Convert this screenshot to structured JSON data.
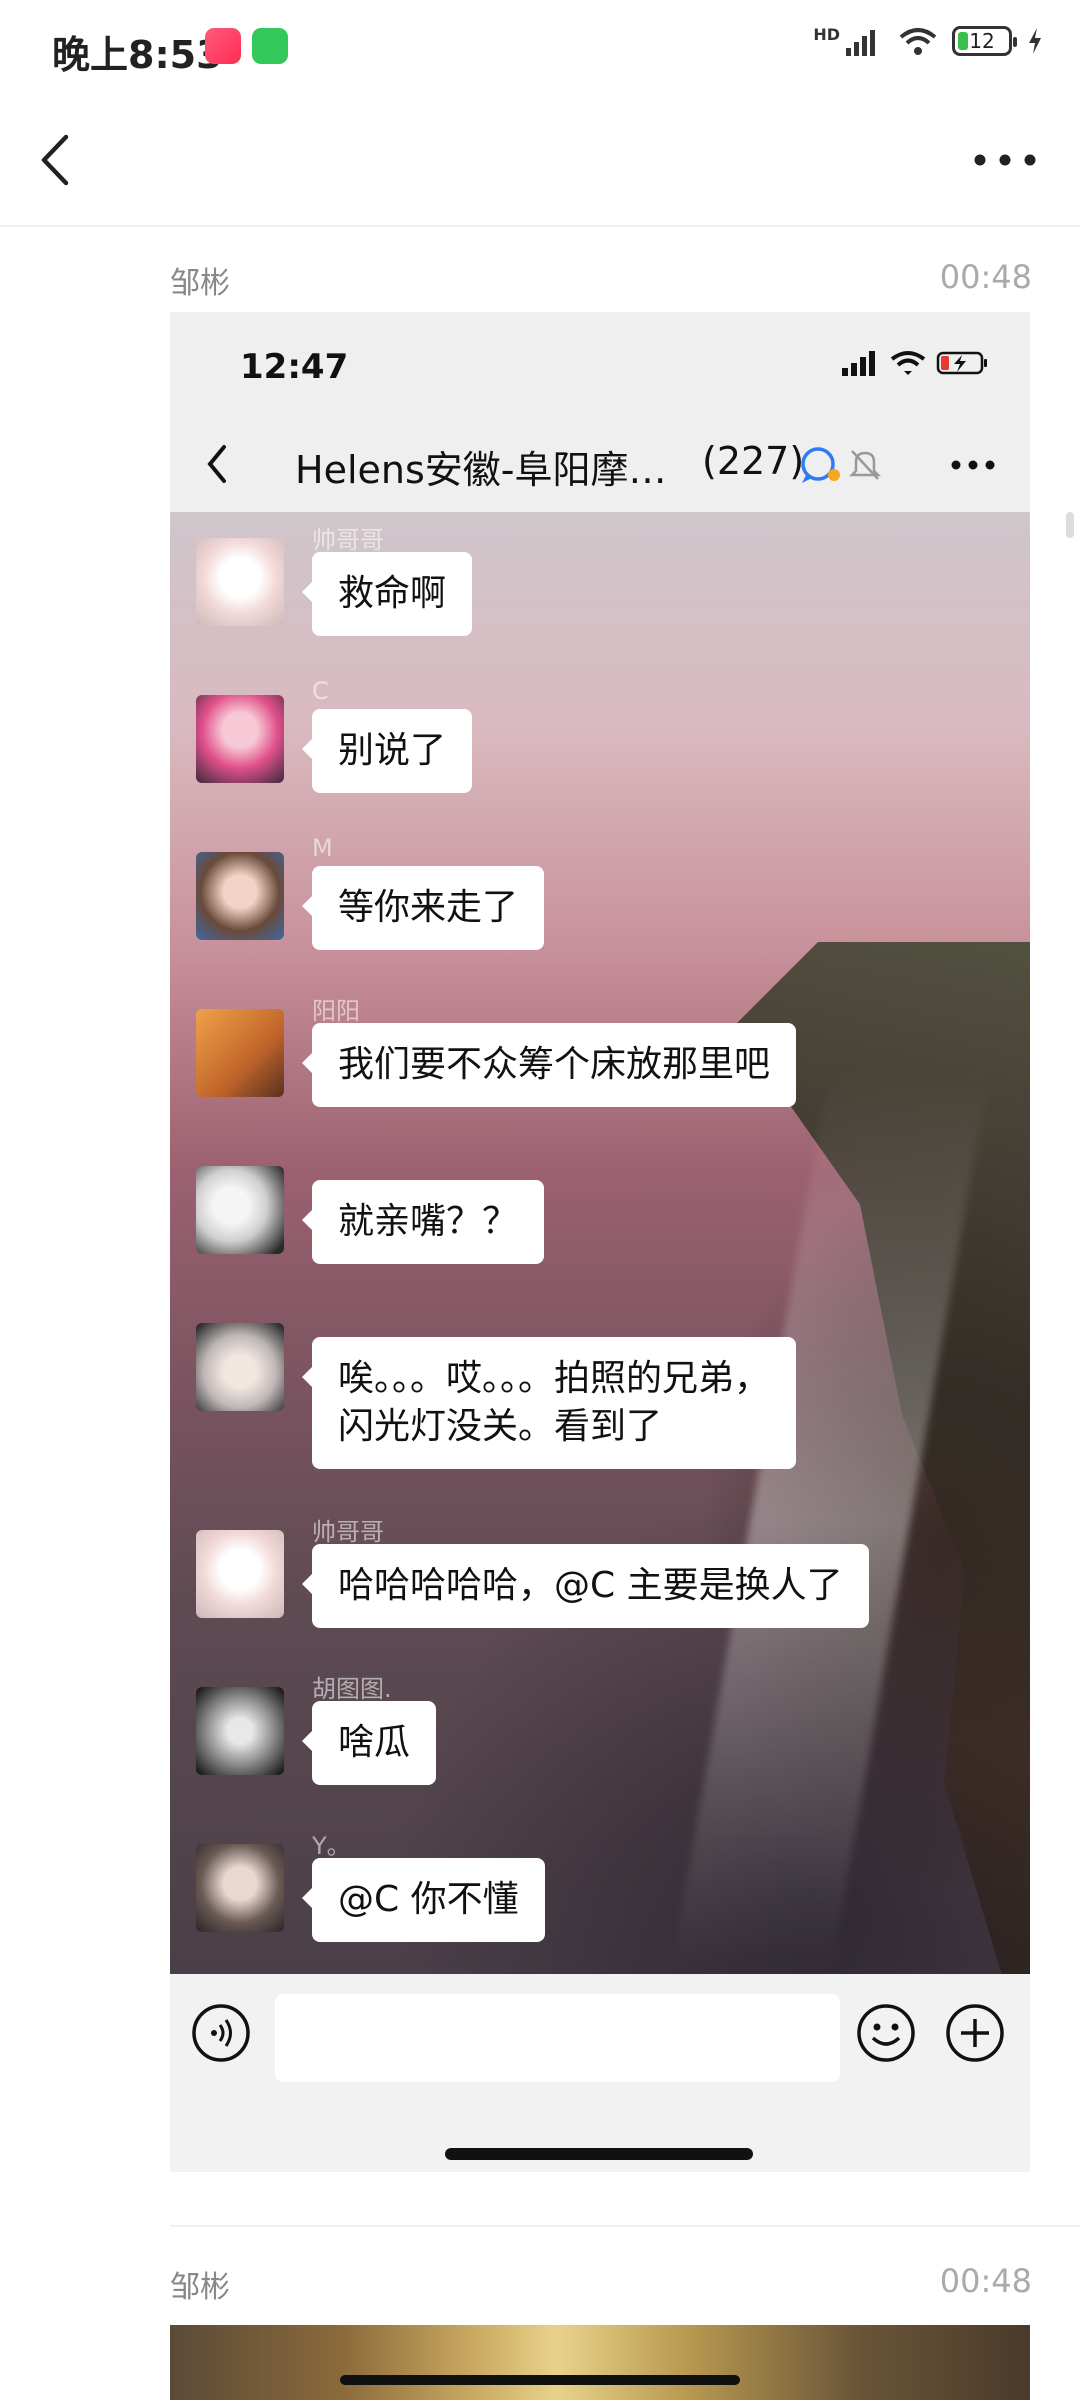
{
  "status_bar": {
    "time": "晚上8:53",
    "battery": "12",
    "network": "HD"
  },
  "nav": {
    "back_icon": "chevron-left-icon",
    "more_icon": "more-horizontal-icon"
  },
  "post1": {
    "sender": "邹彬",
    "time": "00:48"
  },
  "post2": {
    "sender": "邹彬",
    "time": "00:48"
  },
  "screenshot": {
    "status_time": "12:47",
    "chat_title": "Helens安徽-阜阳摩…",
    "member_count": "(227)",
    "messages": [
      {
        "nick": "帅哥哥",
        "text": "救命啊"
      },
      {
        "nick": "C",
        "text": "别说了"
      },
      {
        "nick": "M",
        "text": "等你来走了"
      },
      {
        "nick": "阳阳",
        "text": "我们要不众筹个床放那里吧"
      },
      {
        "nick": "",
        "text": "就亲嘴？？"
      },
      {
        "nick": "",
        "text": "唉。。。哎。。。拍照的兄弟，\n闪光灯没关。看到了"
      },
      {
        "nick": "帅哥哥",
        "text": "哈哈哈哈哈，@C 主要是换人了"
      },
      {
        "nick": "胡图图.",
        "text": "啥瓜"
      },
      {
        "nick": "Y。",
        "text": "@C 你不懂"
      }
    ]
  }
}
